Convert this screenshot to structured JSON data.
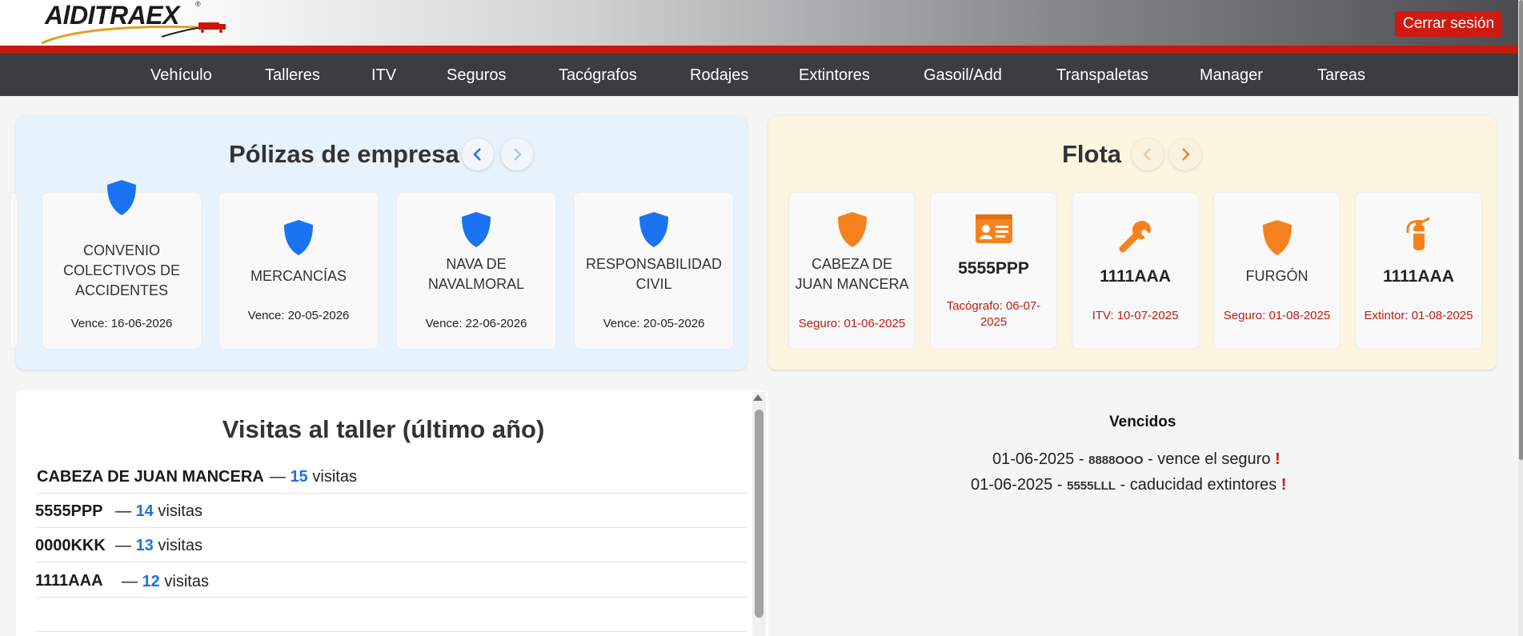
{
  "header": {
    "logo": "AlDITRAEX",
    "logo_reg": "®",
    "logout_label": "Cerrar sesión"
  },
  "nav": {
    "items": [
      "Vehículo",
      "Talleres",
      "ITV",
      "Seguros",
      "Tacógrafos",
      "Rodajes",
      "Extintores",
      "Gasoil/Add",
      "Transpaletas",
      "Manager",
      "Tareas"
    ]
  },
  "policies": {
    "title": "Pólizas de empresa",
    "cards": [
      {
        "name": "CONVENIO COLECTIVOS DE ACCIDENTES",
        "date": "Vence: 16-06-2026",
        "icon": "shield-icon"
      },
      {
        "name": "MERCANCÍAS",
        "date": "Vence: 20-05-2026",
        "icon": "shield-icon"
      },
      {
        "name": "NAVA DE NAVALMORAL",
        "date": "Vence: 22-06-2026",
        "icon": "shield-icon"
      },
      {
        "name": "RESPONSABILIDAD CIVIL",
        "date": "Vence: 20-05-2026",
        "icon": "shield-icon"
      }
    ]
  },
  "fleet": {
    "title": "Flota",
    "cards": [
      {
        "name": "CABEZA DE JUAN MANCERA",
        "date": "Seguro: 01-06-2025",
        "icon": "shield-icon"
      },
      {
        "name": "5555PPP",
        "date": "Tacógrafo: 06-07-2025",
        "icon": "id-card-icon"
      },
      {
        "name": "1111AAA",
        "date": "ITV: 10-07-2025",
        "icon": "wrench-icon"
      },
      {
        "name": "FURGÓN",
        "date": "Seguro: 01-08-2025",
        "icon": "shield-icon"
      },
      {
        "name": "1111AAA",
        "date": "Extintor: 01-08-2025",
        "icon": "fire-extinguisher-icon"
      }
    ]
  },
  "visits": {
    "title": "Visitas al taller (último año)",
    "separator": "—",
    "unit": "visitas",
    "rows": [
      {
        "plate": "CABEZA DE JUAN MANCERA",
        "count": "15"
      },
      {
        "plate": "5555PPP",
        "count": "14"
      },
      {
        "plate": "0000KKK",
        "count": "13"
      },
      {
        "plate": "1111AAA",
        "count": "12"
      }
    ]
  },
  "expired": {
    "title": "Vencidos",
    "items": [
      {
        "date": "01-06-2025",
        "plate": "8888OOO",
        "text": "- vence el seguro",
        "mark": "!"
      },
      {
        "date": "01-06-2025",
        "plate": "5555LLL",
        "text": "- caducidad extintores",
        "mark": "!"
      }
    ]
  },
  "colors": {
    "brand_red": "#c8180c",
    "nav_bg": "#3a3d42",
    "policy_blue": "#1a73f0",
    "fleet_orange": "#f5821f",
    "expired_red": "#c21a10"
  }
}
